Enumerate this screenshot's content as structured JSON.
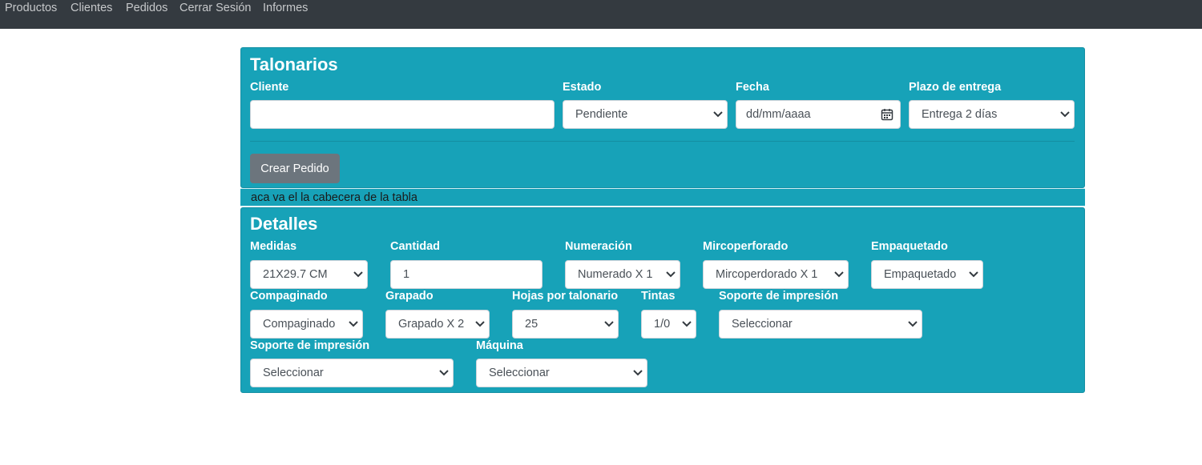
{
  "nav": {
    "items": [
      "Productos",
      "Clientes",
      "Pedidos",
      "Cerrar Sesión",
      "Informes"
    ]
  },
  "colors": {
    "navbar": "#343a40",
    "panel": "#17a2b8",
    "button": "#6c757d"
  },
  "talonarios": {
    "title": "Talonarios",
    "cliente": {
      "label": "Cliente",
      "value": ""
    },
    "estado": {
      "label": "Estado",
      "value": "Pendiente"
    },
    "fecha": {
      "label": "Fecha",
      "placeholder": "dd/mm/aaaa"
    },
    "plazo": {
      "label": "Plazo de entrega",
      "value": "Entrega 2 días"
    },
    "submit": "Crear Pedido"
  },
  "table_header_note": "aca va el la cabecera de la tabla",
  "detalles": {
    "title": "Detalles",
    "medidas": {
      "label": "Medidas",
      "value": "21X29.7 CM"
    },
    "cantidad": {
      "label": "Cantidad",
      "value": "1"
    },
    "numeracion": {
      "label": "Numeración",
      "value": "Numerado X 1"
    },
    "microperforado": {
      "label": "Mircoperforado",
      "value": "Mircoperdorado X 1"
    },
    "empaquetado": {
      "label": "Empaquetado",
      "value": "Empaquetado"
    },
    "compaginado": {
      "label": "Compaginado",
      "value": "Compaginado"
    },
    "grapado": {
      "label": "Grapado",
      "value": "Grapado X 2"
    },
    "hojas": {
      "label": "Hojas por talonario",
      "value": "25"
    },
    "tintas": {
      "label": "Tintas",
      "value": "1/0"
    },
    "soporte1": {
      "label": "Soporte de impresión",
      "value": "Seleccionar"
    },
    "soporte2": {
      "label": "Soporte de impresión",
      "value": "Seleccionar"
    },
    "maquina": {
      "label": "Máquina",
      "value": "Seleccionar"
    }
  }
}
